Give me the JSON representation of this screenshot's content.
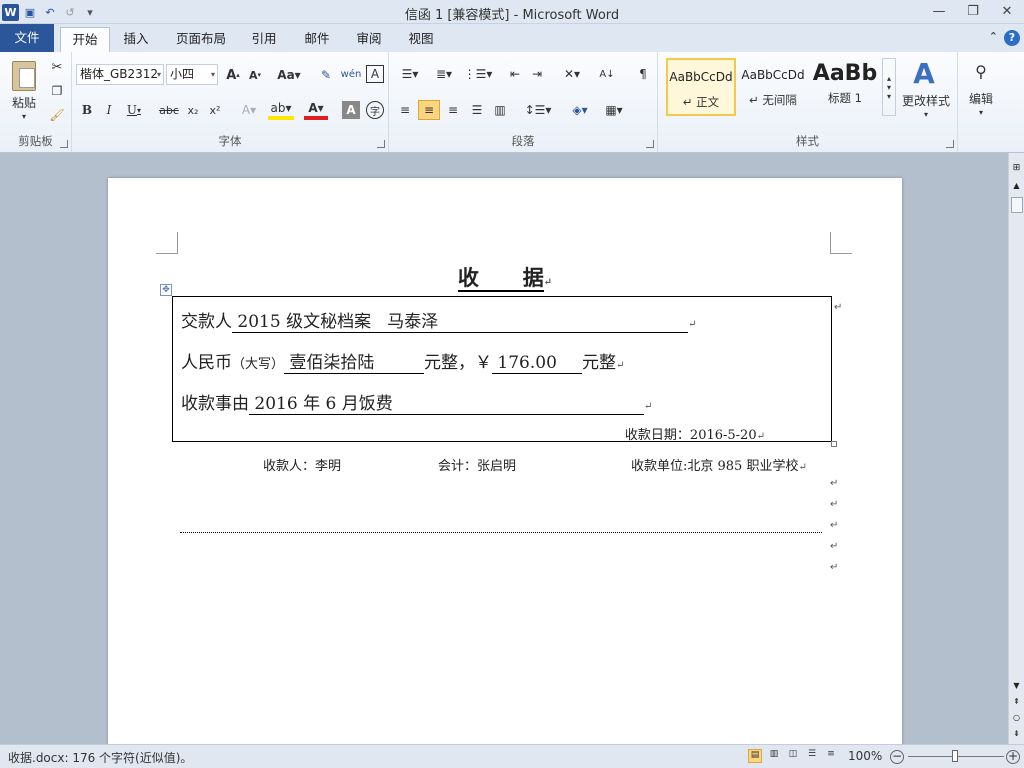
{
  "window": {
    "title": "信函 1 [兼容模式] - Microsoft Word"
  },
  "tabs": [
    "文件",
    "开始",
    "插入",
    "页面布局",
    "引用",
    "邮件",
    "审阅",
    "视图"
  ],
  "ribbon": {
    "clipboard": {
      "label": "剪贴板",
      "paste": "粘贴"
    },
    "font": {
      "label": "字体",
      "family": "楷体_GB2312",
      "size": "小四"
    },
    "paragraph": {
      "label": "段落"
    },
    "styles": {
      "label": "样式",
      "items": [
        {
          "preview": "AaBbCcDd",
          "name": "↵ 正文"
        },
        {
          "preview": "AaBbCcDd",
          "name": "↵ 无间隔"
        },
        {
          "preview": "AaBb",
          "name": "标题 1"
        }
      ],
      "change": "更改样式"
    },
    "edit": {
      "label": "编辑"
    }
  },
  "doc": {
    "title": "收      据",
    "payer_label": "交款人",
    "payer_value": " 2015 级文秘档案   马泰泽",
    "rmb_label": "人民币",
    "rmb_daxie": "（大写）",
    "rmb_words": " 壹佰柒拾陆 ",
    "rmb_yuanzheng1": "元整，￥",
    "rmb_amount": " 176.00 ",
    "rmb_yuanzheng2": "元整",
    "reason_label": "收款事由",
    "reason_value": " 2016 年 6 月饭费",
    "date_label": "收款日期：2016-5-20",
    "payee": "收款人：李明",
    "accountant": "会计：张启明",
    "unit": "收款单位:北京 985 职业学校"
  },
  "status": {
    "left": "收据.docx: 176 个字符(近似值)。",
    "zoom": "100%"
  }
}
